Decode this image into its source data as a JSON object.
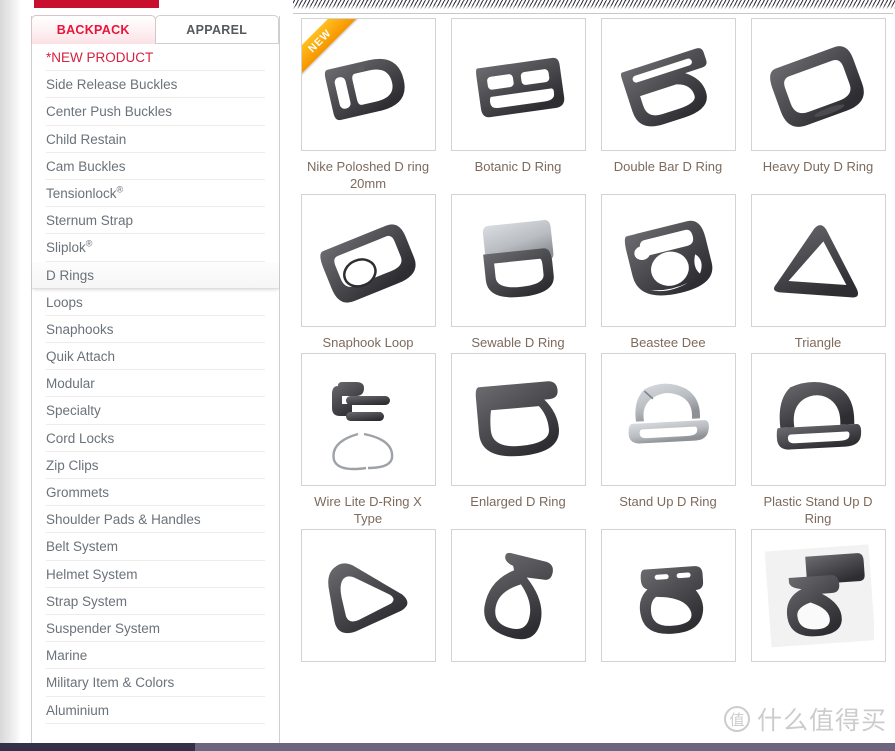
{
  "page": {
    "title": "D Rings Product Catalog",
    "accent_red": "#c8102e",
    "label_color": "#7d6a5c",
    "nav_color": "#6b727a",
    "ribbon_color": "#f79400"
  },
  "sidebar": {
    "tabs": [
      {
        "label": "BACKPACK",
        "active": true
      },
      {
        "label": "APPAREL",
        "active": false
      }
    ],
    "items": [
      {
        "label": "*NEW PRODUCT",
        "style": "newproduct"
      },
      {
        "label": "Side Release Buckles"
      },
      {
        "label": "Center Push Buckles"
      },
      {
        "label": "Child Restain"
      },
      {
        "label": "Cam Buckles"
      },
      {
        "label": "Tensionlock",
        "sup": "®"
      },
      {
        "label": "Sternum Strap"
      },
      {
        "label": "Sliplok",
        "sup": "®"
      },
      {
        "label": "D Rings",
        "active": true
      },
      {
        "label": "Loops"
      },
      {
        "label": "Snaphooks"
      },
      {
        "label": "Quik Attach"
      },
      {
        "label": "Modular"
      },
      {
        "label": "Specialty"
      },
      {
        "label": "Cord Locks"
      },
      {
        "label": "Zip Clips"
      },
      {
        "label": "Grommets"
      },
      {
        "label": "Shoulder Pads & Handles"
      },
      {
        "label": "Belt System"
      },
      {
        "label": "Helmet System"
      },
      {
        "label": "Strap System"
      },
      {
        "label": "Suspender System"
      },
      {
        "label": "Marine"
      },
      {
        "label": "Military Item & Colors"
      },
      {
        "label": "Aluminium"
      }
    ]
  },
  "products": [
    {
      "name": "Nike Poloshed D ring 20mm",
      "badge": "NEW",
      "shape": "nike-d-ring"
    },
    {
      "name": "Botanic D Ring",
      "badge": "",
      "shape": "botanic-d-ring"
    },
    {
      "name": "Double Bar D Ring",
      "badge": "",
      "shape": "double-bar-d-ring"
    },
    {
      "name": "Heavy Duty D Ring",
      "badge": "",
      "shape": "heavy-duty-d-ring"
    },
    {
      "name": "Snaphook Loop",
      "badge": "",
      "shape": "snaphook-loop"
    },
    {
      "name": "Sewable D Ring",
      "badge": "",
      "shape": "sewable-d-ring"
    },
    {
      "name": "Beastee Dee",
      "badge": "",
      "shape": "beastee-dee"
    },
    {
      "name": "Triangle",
      "badge": "",
      "shape": "triangle-ring"
    },
    {
      "name": "Wire Lite D-Ring X Type",
      "badge": "",
      "shape": "wire-lite-x"
    },
    {
      "name": "Enlarged D Ring",
      "badge": "",
      "shape": "enlarged-d-ring"
    },
    {
      "name": "Stand Up D Ring",
      "badge": "",
      "shape": "stand-up-d-ring"
    },
    {
      "name": "Plastic Stand Up D Ring",
      "badge": "",
      "shape": "plastic-stand-up"
    },
    {
      "name": "",
      "badge": "",
      "shape": "soft-triangle"
    },
    {
      "name": "",
      "badge": "",
      "shape": "tall-d-ring"
    },
    {
      "name": "",
      "badge": "",
      "shape": "slotted-d-ring"
    },
    {
      "name": "",
      "badge": "",
      "shape": "tab-d-ring"
    }
  ],
  "watermark": {
    "mark": "值",
    "text": "什么值得买"
  }
}
